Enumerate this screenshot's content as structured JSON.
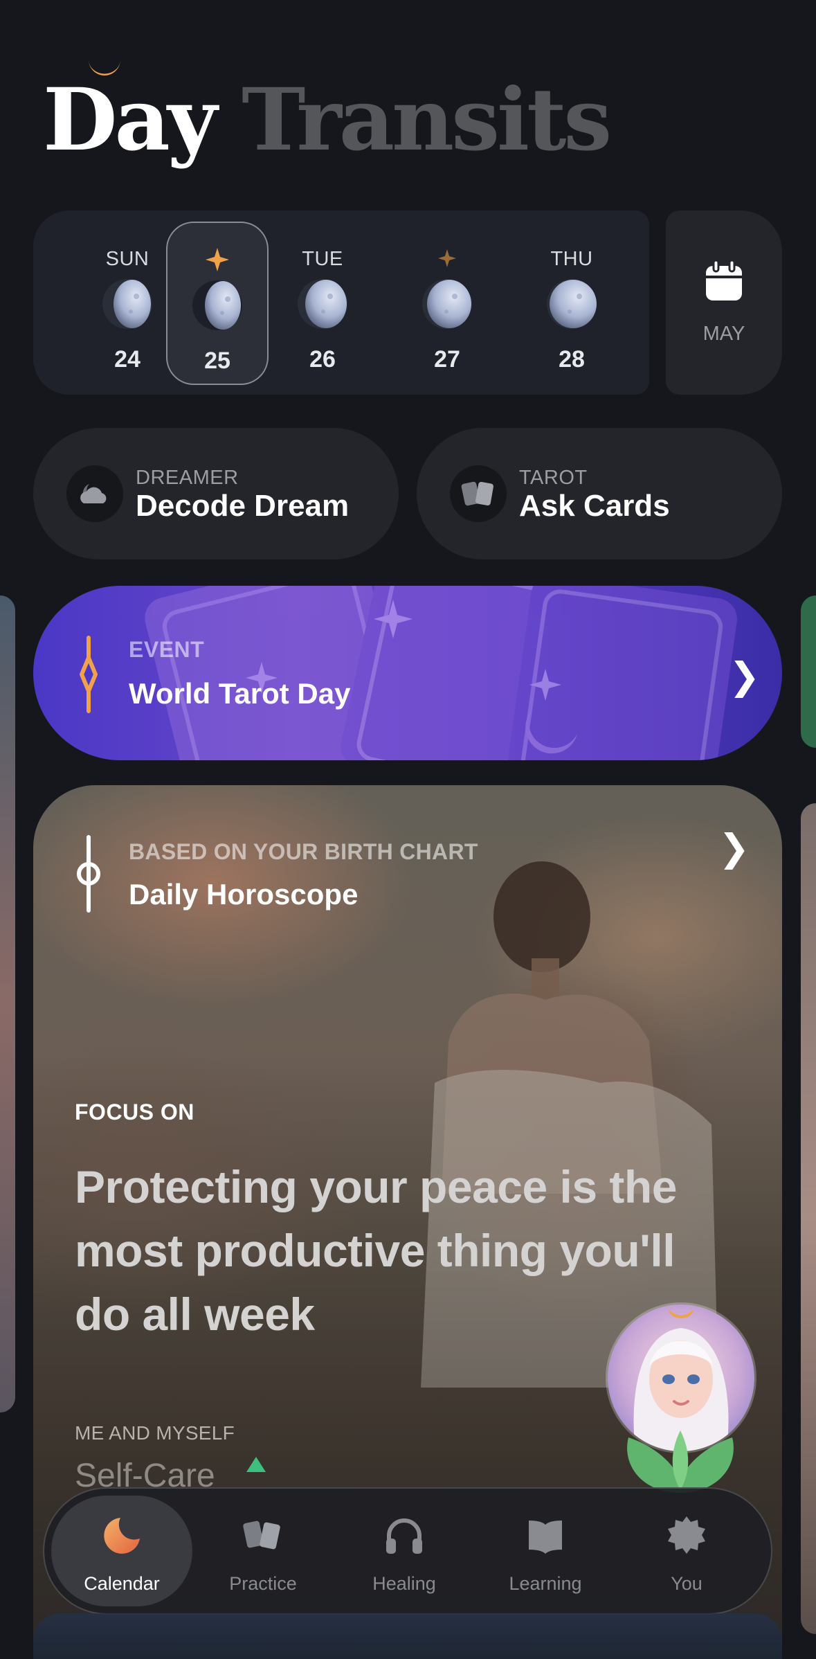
{
  "header": {
    "title_word1": "Day",
    "title_word2": "Transits"
  },
  "week": {
    "days": [
      {
        "name": "SUN",
        "num": "24",
        "star": "none",
        "selected": false
      },
      {
        "name": "",
        "num": "25",
        "star": "bright",
        "selected": true
      },
      {
        "name": "TUE",
        "num": "26",
        "star": "none",
        "selected": false
      },
      {
        "name": "",
        "num": "27",
        "star": "dim",
        "selected": false
      },
      {
        "name": "THU",
        "num": "28",
        "star": "none",
        "selected": false
      }
    ],
    "month_label": "MAY",
    "month_icon": "calendar-icon"
  },
  "actions": [
    {
      "kicker": "DREAMER",
      "title": "Decode Dream",
      "icon": "cloud-moon-icon"
    },
    {
      "kicker": "TAROT",
      "title": "Ask Cards",
      "icon": "tarot-cards-icon"
    }
  ],
  "event": {
    "kicker": "EVENT",
    "title": "World Tarot Day",
    "chevron": "❯"
  },
  "horoscope": {
    "kicker": "BASED ON YOUR BIRTH CHART",
    "title": "Daily Horoscope",
    "chevron": "❯",
    "focus_label": "FOCUS ON",
    "quote": "Protecting your peace is the most productive thing you'll do all week",
    "sub_kicker": "ME AND MYSELF",
    "sub_title": "Self-Care"
  },
  "tabs": [
    {
      "label": "Calendar",
      "icon": "crescent-moon-icon",
      "active": true
    },
    {
      "label": "Practice",
      "icon": "cards-icon",
      "active": false
    },
    {
      "label": "Healing",
      "icon": "headphones-icon",
      "active": false
    },
    {
      "label": "Learning",
      "icon": "book-icon",
      "active": false
    },
    {
      "label": "You",
      "icon": "gear-icon",
      "active": false
    }
  ],
  "colors": {
    "background": "#16171c",
    "accent_orange": "#f0a24a",
    "event_purple": "#5a3cc4",
    "card_surface": "#23252b"
  }
}
